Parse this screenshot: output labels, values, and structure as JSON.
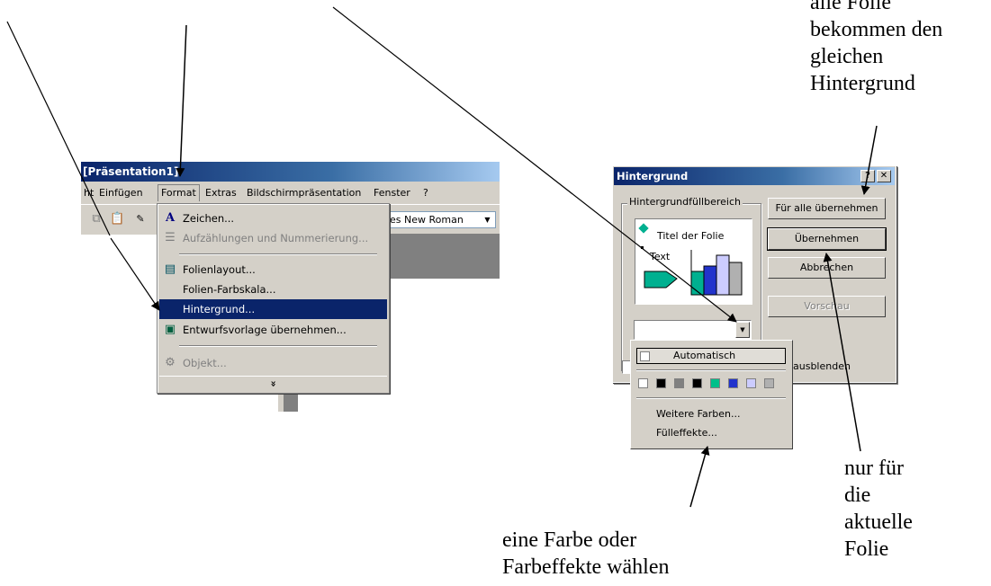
{
  "app": {
    "title": "[Präsentation1]",
    "menu": [
      "ht",
      "Einfügen",
      "Format",
      "Extras",
      "Bildschirmpräsentation",
      "Fenster",
      "?"
    ],
    "font_name": "es New Roman"
  },
  "format_menu": {
    "items": [
      {
        "label": "Zeichen...",
        "icon": "A",
        "enabled": true
      },
      {
        "label": "Aufzählungen und Nummerierung...",
        "icon": "list",
        "enabled": false
      },
      {
        "label": "Folienlayout...",
        "icon": "layout",
        "enabled": true
      },
      {
        "label": "Folien-Farbskala...",
        "icon": "",
        "enabled": true
      },
      {
        "label": "Hintergrund...",
        "icon": "",
        "enabled": true,
        "selected": true
      },
      {
        "label": "Entwurfsvorlage übernehmen...",
        "icon": "template",
        "enabled": true
      },
      {
        "label": "Objekt...",
        "icon": "object",
        "enabled": false
      }
    ],
    "more": "»"
  },
  "dialog": {
    "title": "Hintergrund",
    "group_label": "Hintergrundfüllbereich",
    "preview_title": "Titel der Folie",
    "preview_text": "Text",
    "buttons": {
      "apply_all": "Für alle übernehmen",
      "apply": "Übernehmen",
      "cancel": "Abbrechen",
      "preview": "Vorschau"
    },
    "hide_label": "ausblenden"
  },
  "color_popup": {
    "auto": "Automatisch",
    "swatches": [
      "#ffffff",
      "#000000",
      "#808080",
      "#000000",
      "#00c08a",
      "#2233cc",
      "#ccccff",
      "#b0b0b0"
    ],
    "more_colors": "Weitere Farben...",
    "fill_effects": "Fülleffekte..."
  },
  "notes": {
    "top_right": "alle Folie\nbekommen den\ngleichen\nHintergrund",
    "bottom_right": "nur für\ndie\naktuelle\nFolie",
    "bottom_center": "eine Farbe oder\nFarbeffekte wählen"
  }
}
